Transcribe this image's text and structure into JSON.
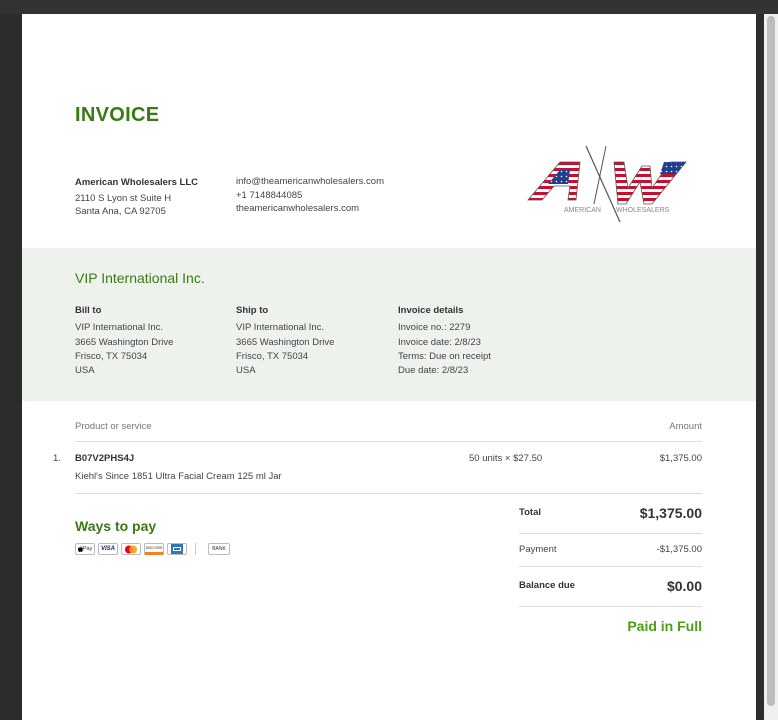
{
  "invoice": {
    "title": "INVOICE",
    "seller": {
      "name": "American Wholesalers LLC",
      "address_line1": "2110 S Lyon st Suite H",
      "address_line2": "Santa Ana, CA 92705",
      "email": "info@theamericanwholesalers.com",
      "phone": "+1 7148844085",
      "website": "theamericanwholesalers.com",
      "logo_letters": "AW",
      "logo_words": [
        "AMERICAN",
        "WHOLESALERS"
      ]
    },
    "customer_name": "VIP International Inc.",
    "bill_to": {
      "heading": "Bill to",
      "lines": [
        "VIP International Inc.",
        "3665 Washington Drive",
        "Frisco, TX 75034",
        "USA"
      ]
    },
    "ship_to": {
      "heading": "Ship to",
      "lines": [
        "VIP International Inc.",
        "3665 Washington Drive",
        "Frisco, TX 75034",
        "USA"
      ]
    },
    "details": {
      "heading": "Invoice details",
      "lines": [
        "Invoice no.: 2279",
        "Invoice date: 2/8/23",
        "Terms: Due on receipt",
        "Due date: 2/8/23"
      ]
    },
    "table": {
      "col_product": "Product or service",
      "col_amount": "Amount",
      "items": [
        {
          "num": "1.",
          "sku": "B07V2PHS4J",
          "description": "Kiehl's Since 1851 Ultra Facial Cream 125 ml Jar",
          "qty": "50 units × $27.50",
          "amount": "$1,375.00"
        }
      ]
    },
    "ways_to_pay": {
      "title": "Ways to pay",
      "icons": [
        "apple-pay-icon",
        "visa-icon",
        "mastercard-icon",
        "discover-icon",
        "amex-icon",
        "bank-icon"
      ],
      "labels": {
        "apple_pay": "Pay",
        "visa": "VISA",
        "discover": "DISCOVER",
        "bank": "BANK"
      }
    },
    "totals": {
      "total_label": "Total",
      "total_value": "$1,375.00",
      "payment_label": "Payment",
      "payment_value": "-$1,375.00",
      "balance_label": "Balance due",
      "balance_value": "$0.00",
      "status": "Paid in Full"
    },
    "colors": {
      "accent": "#3a7a14",
      "paid": "#4aa01a",
      "band": "#eef2ec",
      "logo_red": "#c8102e",
      "logo_blue": "#1f3f8f"
    }
  }
}
